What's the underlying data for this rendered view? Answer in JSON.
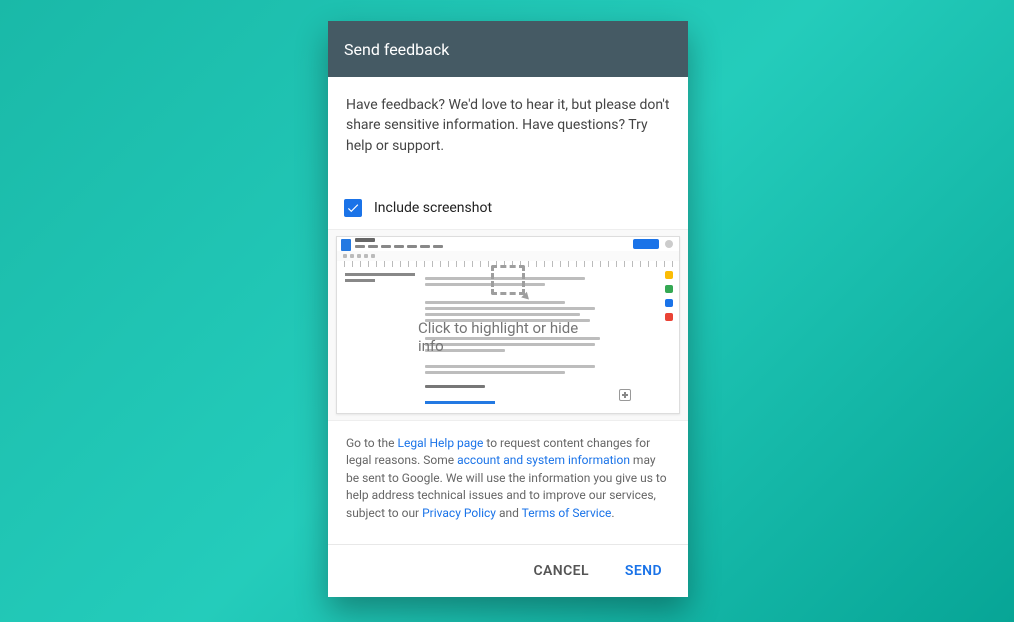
{
  "dialog": {
    "title": "Send feedback",
    "description": "Have feedback? We'd love to hear it, but please don't share sensitive information. Have questions? Try help or support."
  },
  "screenshot_section": {
    "checkbox_label": "Include screenshot",
    "checked": true,
    "overlay_label": "Click to highlight or hide info"
  },
  "legal": {
    "go_to": "Go to the ",
    "legal_help_link": "Legal Help page",
    "after_legal_help": " to request content changes for legal reasons. Some ",
    "account_info_link": "account and system information",
    "after_account_info": " may be sent to Google. We will use the information you give us to help address technical issues and to improve our services, subject to our ",
    "privacy_link": "Privacy Policy",
    "and": " and ",
    "terms_link": "Terms of Service",
    "period": "."
  },
  "actions": {
    "cancel": "CANCEL",
    "send": "SEND"
  }
}
